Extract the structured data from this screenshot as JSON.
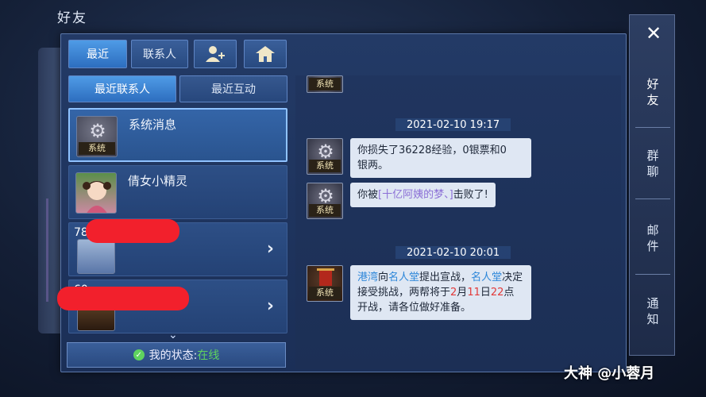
{
  "page_title": "好友",
  "tabs": {
    "recent": "最近",
    "contacts": "联系人",
    "add_friend_icon": "add-user-icon",
    "home_icon": "home-icon"
  },
  "subtabs": {
    "recent_contacts": "最近联系人",
    "recent_interactions": "最近互动"
  },
  "contacts": [
    {
      "name": "系统消息",
      "avatar_label": "系统"
    },
    {
      "name": "倩女小精灵"
    },
    {
      "level": "78"
    },
    {
      "level": "60"
    }
  ],
  "status": {
    "label": "我的状态: ",
    "value": "在线"
  },
  "chat": {
    "top_tag": "系统",
    "messages": [
      {
        "timestamp": "2021-02-10 19:17"
      },
      {
        "sender_tag": "系统",
        "line1": "你损失了36228经验，0银票和0",
        "line2": "银两。"
      },
      {
        "sender_tag": "系统",
        "prefix": "你被",
        "highlight": "[十亿阿姨的梦、]",
        "suffix": "击败了!"
      },
      {
        "timestamp": "2021-02-10 20:01"
      },
      {
        "sender_tag": "系统",
        "p1": "港湾",
        "p2": "向",
        "p3": "名人堂",
        "p4": "提出宣战，",
        "p5": "名人堂",
        "p6": "决定接受挑战，两帮将于",
        "p7": "2",
        "p8": "月",
        "p9": "11",
        "p10": "日",
        "p11": "22",
        "p12": "点开战，请各位做好准备。"
      }
    ]
  },
  "right_nav": {
    "friends": "好友",
    "group_chat": "群聊",
    "mail": "邮件",
    "notice": "通知"
  },
  "watermark": "大神 @小蓉月"
}
